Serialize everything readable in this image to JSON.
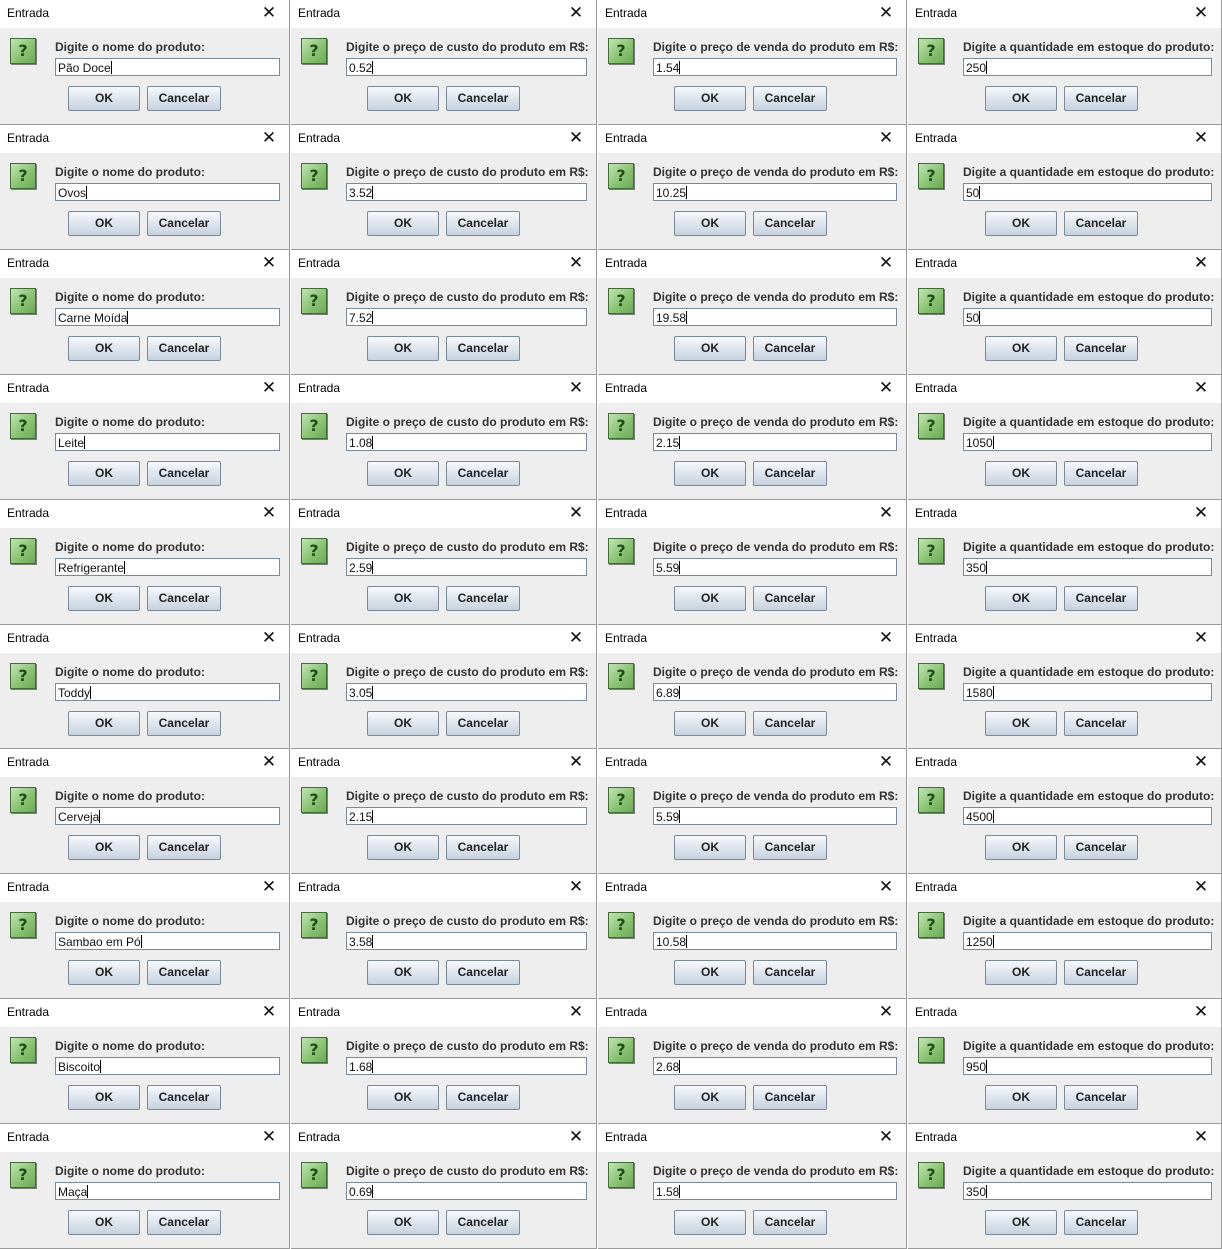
{
  "dialog": {
    "title": "Entrada",
    "close_glyph": "✕",
    "icon": "question-icon",
    "icon_glyph": "?",
    "ok_label": "OK",
    "cancel_label": "Cancelar"
  },
  "prompts": {
    "name": "Digite o nome do produto:",
    "cost": "Digite o preço de custo do produto em R$:",
    "sale": "Digite o preço de venda do produto em R$:",
    "stock": "Digite a quantidade em estoque do produto:"
  },
  "products": [
    {
      "name": "Pão Doce",
      "cost": "0.52",
      "sale": "1.54",
      "stock": "250"
    },
    {
      "name": "Ovos",
      "cost": "3.52",
      "sale": "10.25",
      "stock": "50"
    },
    {
      "name": "Carne Moída",
      "cost": "7.52",
      "sale": "19.58",
      "stock": "50"
    },
    {
      "name": "Leite",
      "cost": "1.08",
      "sale": "2.15",
      "stock": "1050"
    },
    {
      "name": "Refrigerante",
      "cost": "2.59",
      "sale": "5.59",
      "stock": "350"
    },
    {
      "name": "Toddy",
      "cost": "3.05",
      "sale": "6.89",
      "stock": "1580"
    },
    {
      "name": "Cerveja",
      "cost": "2.15",
      "sale": "5.59",
      "stock": "4500"
    },
    {
      "name": "Sambao em Pó",
      "cost": "3.58",
      "sale": "10.58",
      "stock": "1250"
    },
    {
      "name": "Biscoito",
      "cost": "1.68",
      "sale": "2.68",
      "stock": "950"
    },
    {
      "name": "Maça",
      "cost": "0.69",
      "sale": "1.58",
      "stock": "350"
    }
  ],
  "colors": {
    "dialog_background": "#eeeeee",
    "title_bar": "#ffffff",
    "icon_green": "#86c06f",
    "button_face": "#dce3ec",
    "prompt_text": "#333333"
  }
}
